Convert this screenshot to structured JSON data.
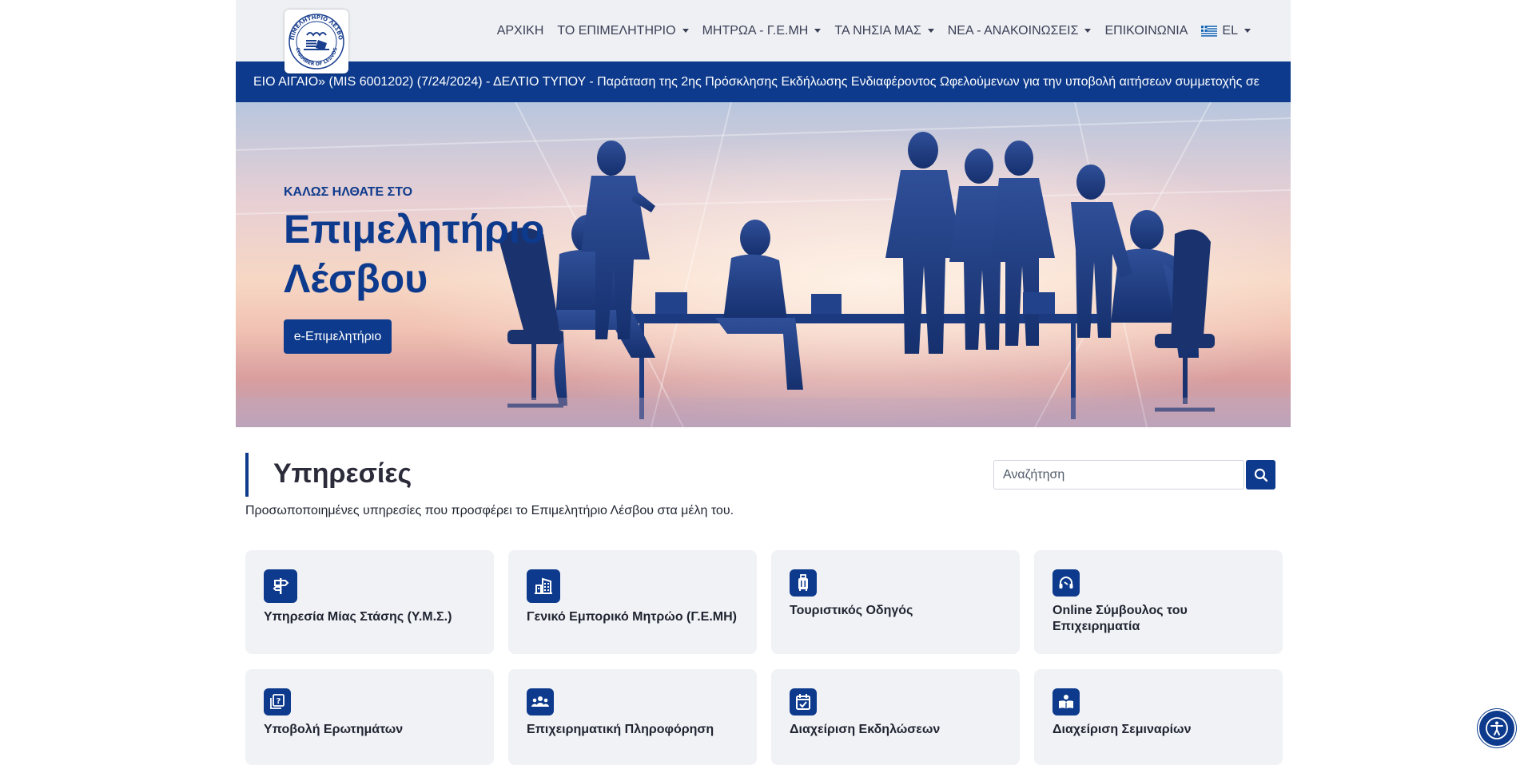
{
  "header": {
    "logo_alt": "ΕΠΙΜΕΛΗΤΗΡΙΟ ΛΕΣΒΟΥ CHAMBER OF LESVOS",
    "nav": {
      "home": "ΑΡΧΙΚΗ",
      "chamber": "ΤΟ ΕΠΙΜΕΛΗΤΗΡΙΟ",
      "registry": "ΜΗΤΡΩΑ - Γ.Ε.ΜΗ",
      "islands": "ΤΑ ΝΗΣΙΑ ΜΑΣ",
      "news": "ΝΕΑ - ΑΝΑΚΟΙΝΩΣΕΙΣ",
      "contact": "ΕΠΙΚΟΙΝΩΝΙΑ",
      "language": "EL"
    }
  },
  "ticker": {
    "text": "ΕΙΟ ΑΙΓΑΙΟ» (MIS 6001202)   (7/24/2024) - ΔΕΛΤΙΟ ΤΥΠΟΥ - Παράταση της 2ης Πρόσκλησης Εκδήλωσης Ενδιαφέροντος Ωφελούμενων για την υποβολή αιτήσεων συμμετοχής σε"
  },
  "hero": {
    "kicker": "ΚΑΛΩΣ ΗΛΘΑΤΕ ΣΤΟ",
    "title": "Επιμελητήριο Λέσβου",
    "button": "e-Επιμελητήριο"
  },
  "services": {
    "title": "Υπηρεσίες",
    "subtitle": "Προσωποποιημένες υπηρεσίες που προσφέρει το Επιμελητήριο Λέσβου στα μέλη του.",
    "search_placeholder": "Αναζήτηση",
    "cards": [
      {
        "label": "Υπηρεσία Μίας Στάσης (Υ.Μ.Σ.)",
        "icon": "signpost-icon"
      },
      {
        "label": "Γενικό Εμπορικό Μητρώο (Γ.Ε.ΜΗ)",
        "icon": "buildings-icon"
      },
      {
        "label": "Τουριστικός Οδηγός",
        "icon": "luggage-icon"
      },
      {
        "label": "Online Σύμβουλος του Επιχειρηματία",
        "icon": "headset-icon"
      },
      {
        "label": "Υποβολή Ερωτημάτων",
        "icon": "question-icon"
      },
      {
        "label": "Επιχειρηματική Πληροφόρηση",
        "icon": "group-icon"
      },
      {
        "label": "Διαχείριση Εκδηλώσεων",
        "icon": "calendar-check-icon"
      },
      {
        "label": "Διαχείριση Σεμιναρίων",
        "icon": "reader-icon"
      }
    ]
  },
  "colors": {
    "primary": "#0d3a8c",
    "header_bg": "#eef0f4",
    "card_bg": "#f1f2f6"
  }
}
